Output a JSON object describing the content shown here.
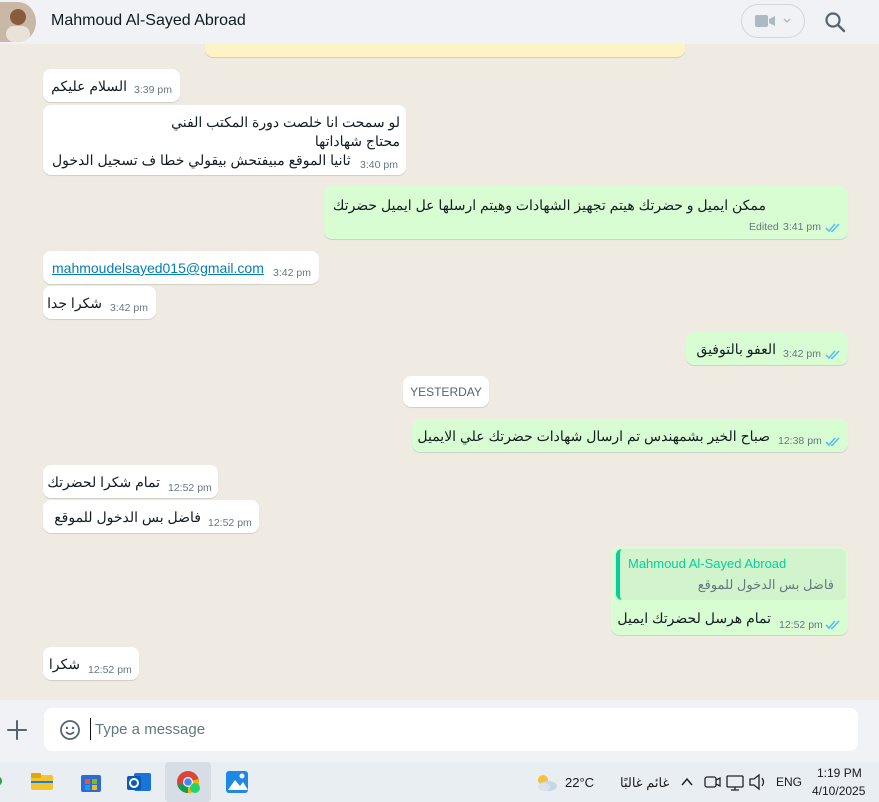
{
  "header": {
    "contact_name": "Mahmoud Al-Sayed Abroad"
  },
  "chat": {
    "date_separator": "YESTERDAY",
    "messages": [
      {
        "dir": "in",
        "text": "السلام عليكم",
        "time": "3:39 pm"
      },
      {
        "dir": "in",
        "lines": [
          "لو سمحت انا خلصت دورة المكتب الفني",
          "محتاج شهاداتها",
          "ثانيا الموقع مبيفتحش بيقولي خطا ف تسجيل الدخول"
        ],
        "time": "3:40 pm"
      },
      {
        "dir": "out",
        "text": "ممكن ايميل و حضرتك هيتم تجهيز الشهادات وهيتم ارسلها عل ايميل حضرتك",
        "edited": "Edited",
        "time": "3:41 pm"
      },
      {
        "dir": "in",
        "text": "mahmoudelsayed015@gmail.com",
        "time": "3:42 pm"
      },
      {
        "dir": "in",
        "text": "شكرا جدا",
        "time": "3:42 pm"
      },
      {
        "dir": "out",
        "text": "العفو بالتوفيق",
        "time": "3:42 pm"
      },
      {
        "dir": "out",
        "text": "صباح الخير بشمهندس تم ارسال شهادات حضرتك علي الايميل",
        "time": "12:38 pm"
      },
      {
        "dir": "in",
        "text": "تمام شكرا لحضرتك",
        "time": "12:52 pm"
      },
      {
        "dir": "in",
        "text": "فاضل بس الدخول للموقع",
        "time": "12:52 pm"
      },
      {
        "dir": "out",
        "quote_name": "Mahmoud Al-Sayed Abroad",
        "quote_text": "فاضل بس الدخول للموقع",
        "text": "تمام هرسل لحضرتك ايميل",
        "time": "12:52 pm"
      },
      {
        "dir": "in",
        "text": "شكرا",
        "time": "12:52 pm"
      }
    ]
  },
  "composer": {
    "placeholder": "Type a message"
  },
  "taskbar": {
    "weather_temp": "22°C",
    "weather_desc": "غائم غالبًا",
    "language": "ENG",
    "time": "1:19 PM",
    "date": "4/10/2025"
  },
  "colors": {
    "incoming_bubble": "#ffffff",
    "outgoing_bubble": "#d9fdd3",
    "chat_background": "#efeae2",
    "read_ticks": "#53bdeb",
    "quote_accent": "#06cf9c"
  }
}
